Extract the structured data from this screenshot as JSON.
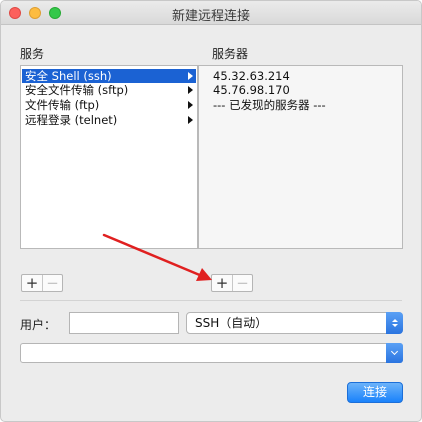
{
  "window": {
    "title": "新建远程连接"
  },
  "services": {
    "label": "服务",
    "items": [
      {
        "label": "安全 Shell (ssh)",
        "selected": true
      },
      {
        "label": "安全文件传输 (sftp)",
        "selected": false
      },
      {
        "label": "文件传输 (ftp)",
        "selected": false
      },
      {
        "label": "远程登录 (telnet)",
        "selected": false
      }
    ],
    "add_symbol": "+",
    "remove_symbol": "−"
  },
  "servers": {
    "label": "服务器",
    "items": [
      {
        "label": "45.32.63.214"
      },
      {
        "label": "45.76.98.170"
      },
      {
        "label": "--- 已发现的服务器 ---"
      }
    ],
    "add_symbol": "+",
    "remove_symbol": "−"
  },
  "user": {
    "label": "用户：",
    "value": ""
  },
  "protocol": {
    "selected": "SSH（自动）"
  },
  "command": {
    "value": ""
  },
  "actions": {
    "connect_label": "连接"
  },
  "colors": {
    "selection": "#1b62d3",
    "accent": "#1a82fb",
    "annotation_arrow": "#e02020"
  }
}
